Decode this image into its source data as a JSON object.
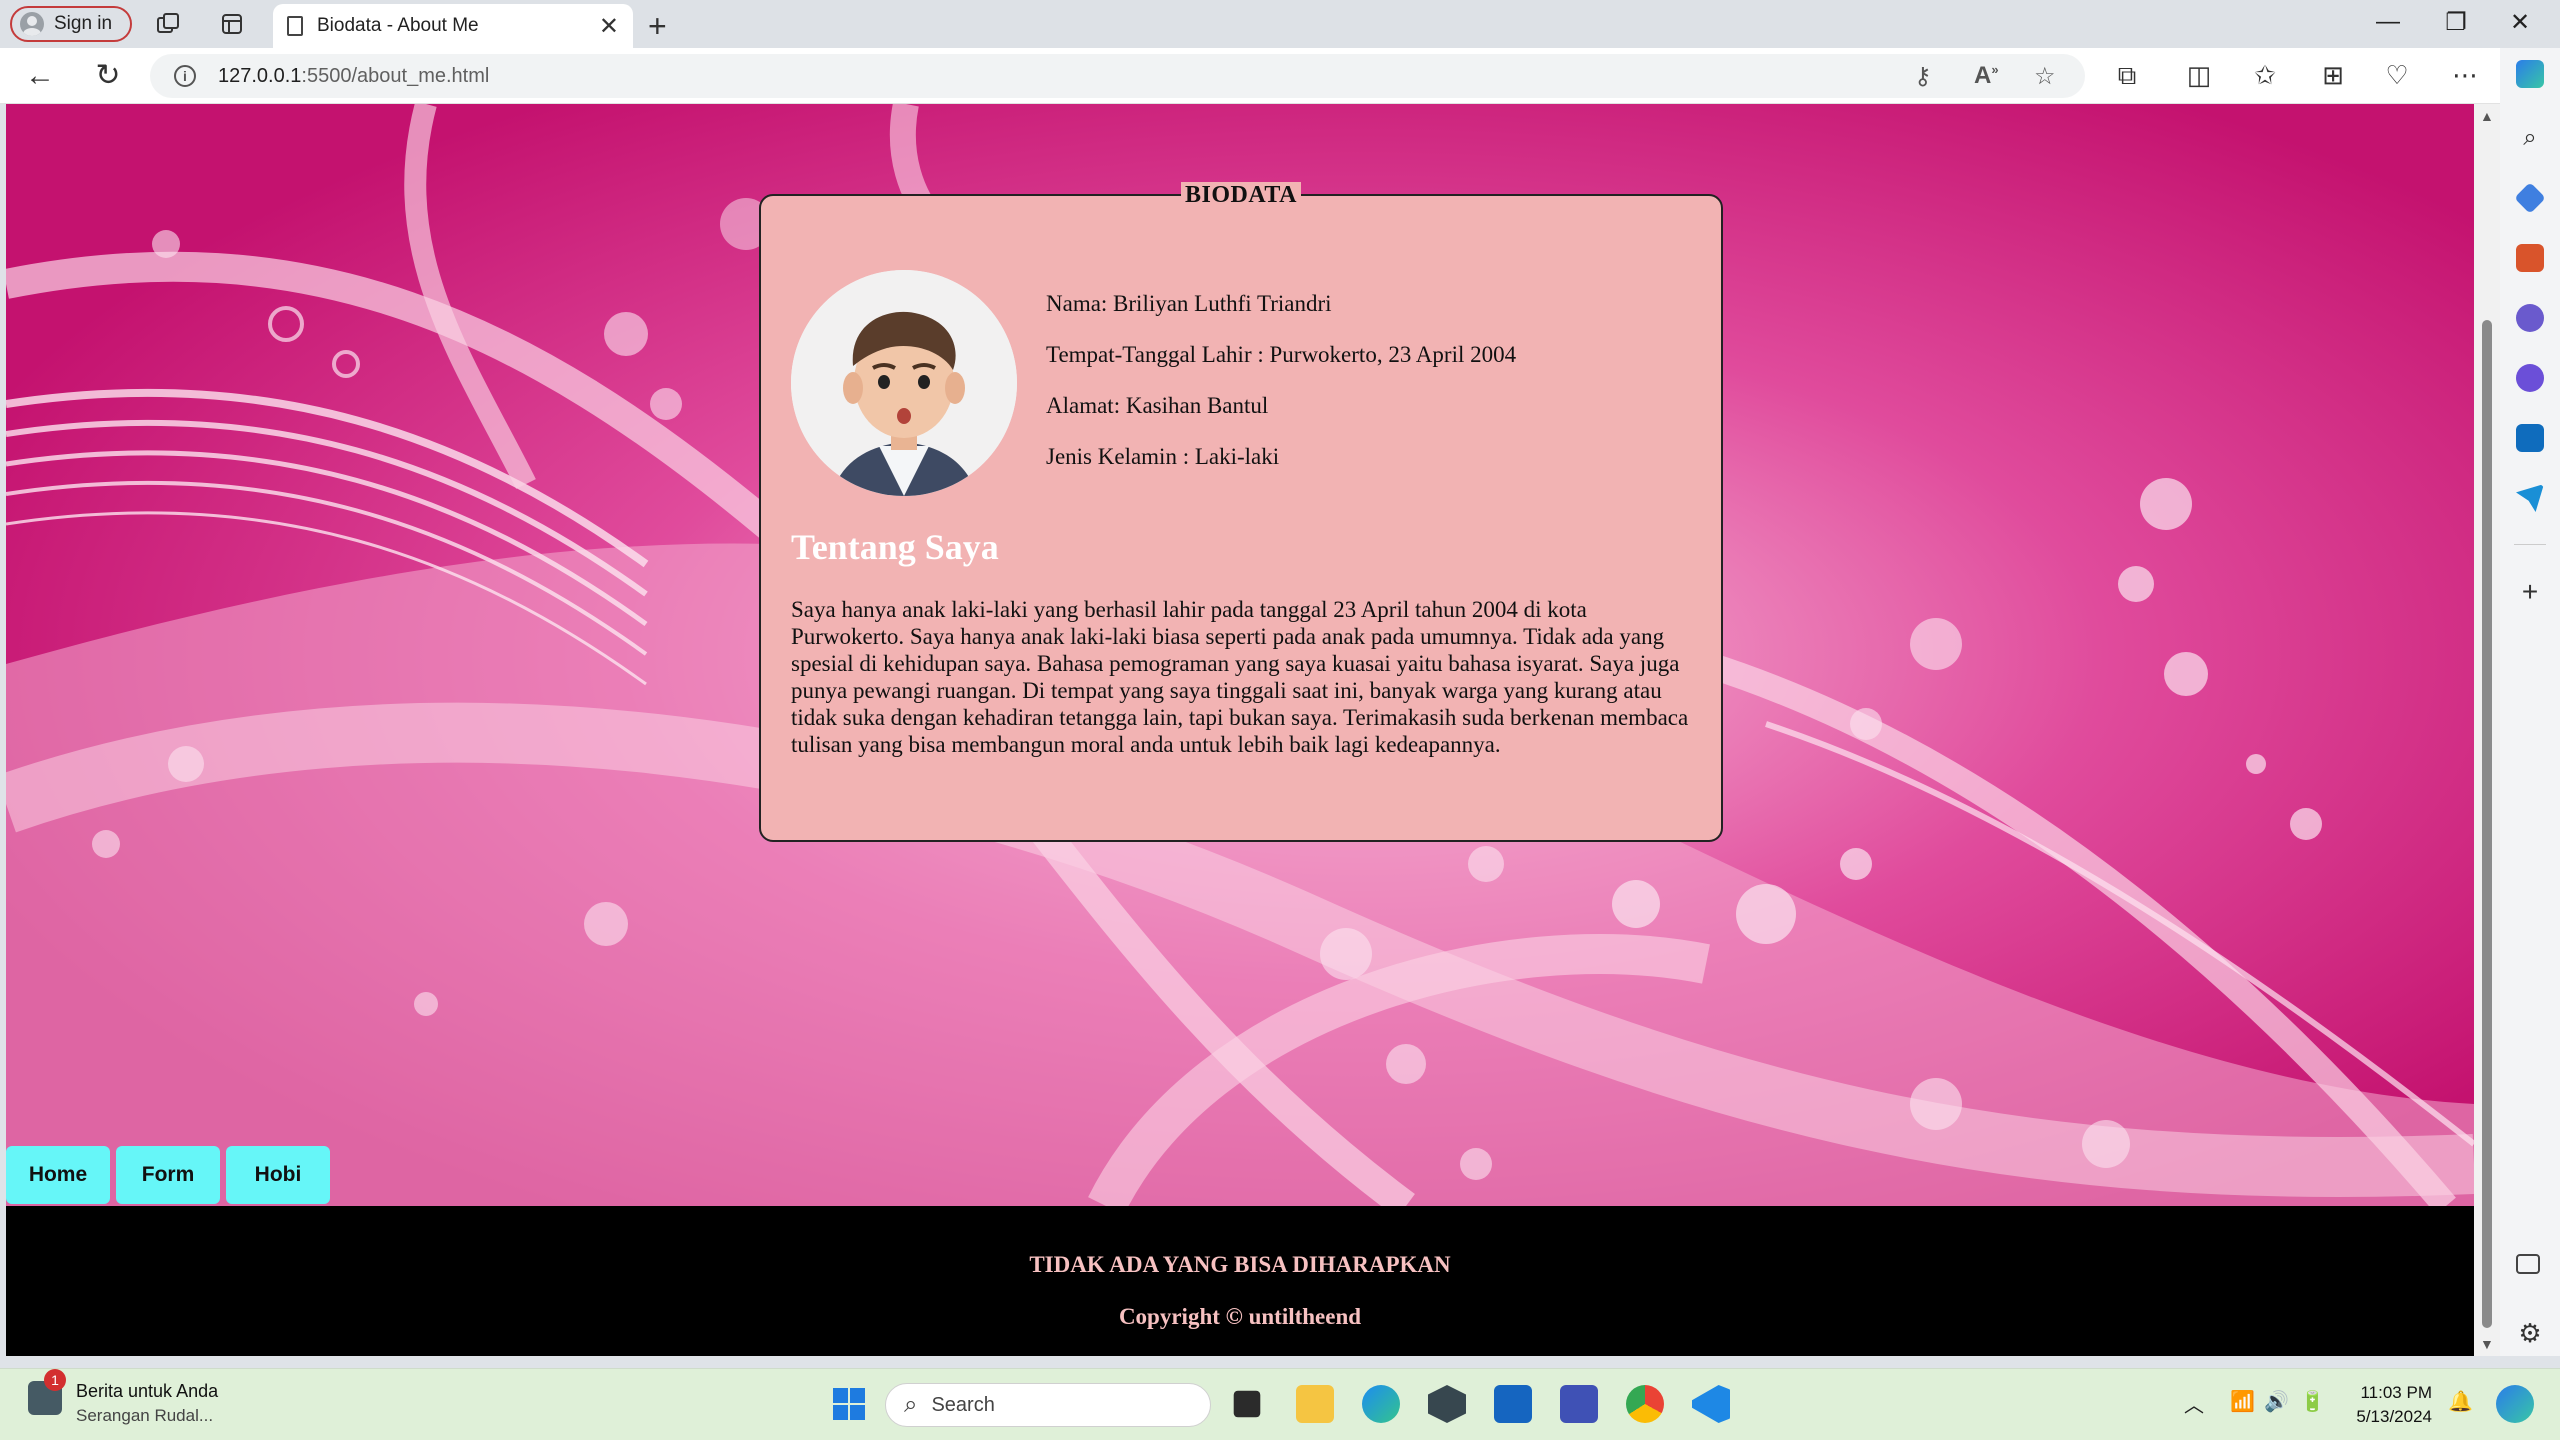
{
  "browser": {
    "signin_label": "Sign in",
    "tab_title": "Biodata - About Me",
    "url_host": "127.0.0.1",
    "url_path": ":5500/about_me.html"
  },
  "page": {
    "card_legend": "BIODATA",
    "nama": "Nama: Briliyan Luthfi Triandri",
    "ttl": "Tempat-Tanggal Lahir : Purwokerto, 23 April 2004",
    "alamat": "Alamat: Kasihan Bantul",
    "kelamin": "Jenis Kelamin : Laki-laki",
    "about_title": "Tentang Saya",
    "about_text": "Saya hanya anak laki-laki yang berhasil lahir pada tanggal 23 April tahun 2004 di kota Purwokerto. Saya hanya anak laki-laki biasa seperti pada anak pada umumnya. Tidak ada yang spesial di kehidupan saya. Bahasa pemograman yang saya kuasai yaitu bahasa isyarat. Saya juga punya pewangi ruangan. Di tempat yang saya tinggali saat ini, banyak warga yang kurang atau tidak suka dengan kehadiran tetangga lain, tapi bukan saya. Terimakasih suda berkenan membaca tulisan yang bisa membangun moral anda untuk lebih baik lagi kedeapannya.",
    "menu": [
      "Home",
      "Form",
      "Hobi"
    ],
    "footer_line1": "TIDAK ADA YANG BISA DIHARAPKAN",
    "footer_line2": "Copyright © untiltheend"
  },
  "taskbar": {
    "news_title": "Berita untuk Anda",
    "news_sub": "Serangan Rudal...",
    "news_badge": "1",
    "search_placeholder": "Search",
    "time": "11:03 PM",
    "date": "5/13/2024"
  },
  "colors": {
    "card_bg": "#f2b3b3",
    "menu_bg": "#66f6f8",
    "footer_text": "#f7c1c1",
    "page_bg": "#c8157a"
  }
}
